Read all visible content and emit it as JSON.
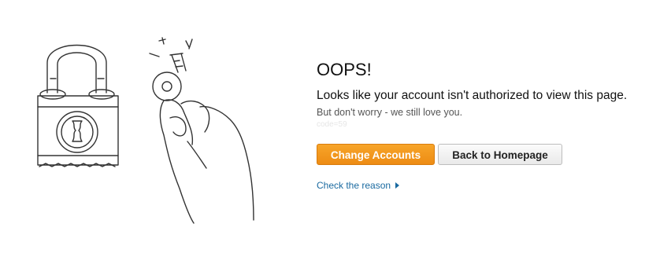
{
  "message": {
    "title": "OOPS!",
    "subtitle": "Looks like your account isn't authorized to view this page.",
    "note": "But don't worry - we still love you.",
    "code": "code=59"
  },
  "actions": {
    "change_accounts_label": "Change Accounts",
    "back_home_label": "Back to Homepage"
  },
  "links": {
    "check_reason_label": "Check the reason"
  },
  "colors": {
    "primary_button": "#f0941c",
    "link": "#1a6aa0"
  },
  "icons": {
    "illustration": "padlock-and-key-hand-illustration",
    "reason_arrow": "caret-right-icon"
  }
}
